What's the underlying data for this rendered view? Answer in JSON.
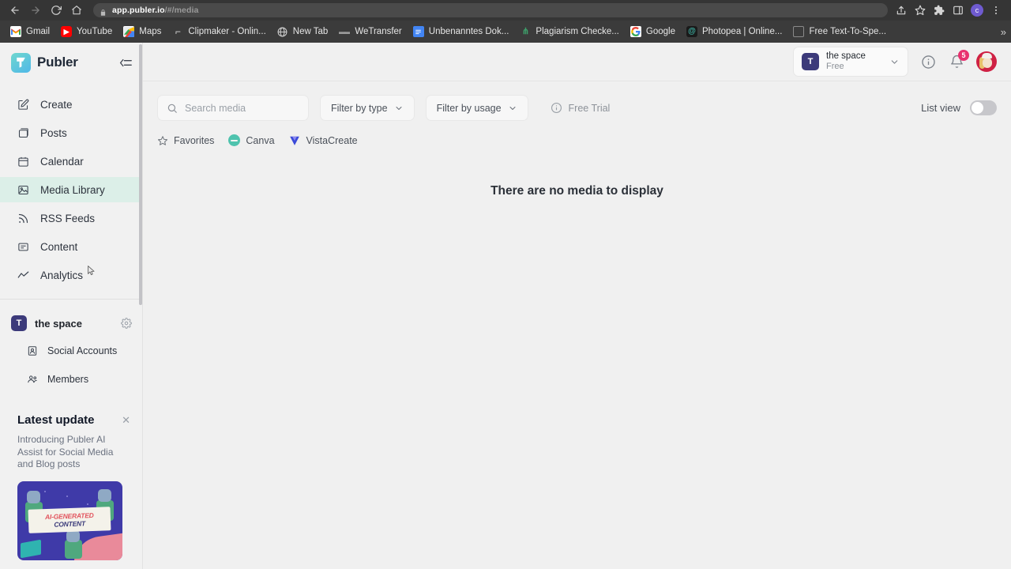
{
  "browser": {
    "url_host": "app.publer.io",
    "url_path": "/#/media",
    "nav": {
      "back": "back-arrow",
      "forward": "forward-arrow",
      "reload": "reload",
      "home": "home"
    },
    "actions": {
      "share": "share-icon",
      "bookmark": "star-icon",
      "extensions": "puzzle-icon",
      "sidepanel": "side-panel-icon",
      "profile_initial": "c",
      "menu": "kebab-menu-icon"
    },
    "bookmarks": [
      {
        "label": "Gmail",
        "icon": "gmail-icon"
      },
      {
        "label": "YouTube",
        "icon": "youtube-icon"
      },
      {
        "label": "Maps",
        "icon": "google-maps-icon"
      },
      {
        "label": "Clipmaker - Onlin...",
        "icon": "clipmaker-icon"
      },
      {
        "label": "New Tab",
        "icon": "globe-icon"
      },
      {
        "label": "WeTransfer",
        "icon": "wetransfer-icon"
      },
      {
        "label": "Unbenanntes Dok...",
        "icon": "google-docs-icon"
      },
      {
        "label": "Plagiarism Checke...",
        "icon": "plagiarism-icon"
      },
      {
        "label": "Google",
        "icon": "google-icon"
      },
      {
        "label": "Photopea | Online...",
        "icon": "photopea-icon"
      },
      {
        "label": "Free Text-To-Spe...",
        "icon": "tts-icon"
      }
    ],
    "bookmarks_overflow": "»"
  },
  "sidebar": {
    "logo_text": "Publer",
    "collapse_label": "collapse-sidebar",
    "nav_items": [
      {
        "label": "Create",
        "icon": "create-pencil-icon",
        "active": false
      },
      {
        "label": "Posts",
        "icon": "posts-icon",
        "active": false
      },
      {
        "label": "Calendar",
        "icon": "calendar-icon",
        "active": false
      },
      {
        "label": "Media Library",
        "icon": "media-library-icon",
        "active": true
      },
      {
        "label": "RSS Feeds",
        "icon": "rss-feed-icon",
        "active": false
      },
      {
        "label": "Content",
        "icon": "content-icon",
        "active": false
      },
      {
        "label": "Analytics",
        "icon": "analytics-icon",
        "active": false
      }
    ],
    "workspace": {
      "initial": "T",
      "name": "the space",
      "settings_icon": "gear-icon"
    },
    "sub_items": [
      {
        "label": "Social Accounts",
        "icon": "social-accounts-icon"
      },
      {
        "label": "Members",
        "icon": "members-icon"
      }
    ],
    "update_card": {
      "title": "Latest update",
      "close_icon": "close-icon",
      "body": "Introducing Publer AI Assist for Social Media and Blog posts",
      "image_line1_prefix": "AI",
      "image_line1": "AI-GENERATED",
      "image_line2": "CONTENT"
    }
  },
  "topbar": {
    "workspace_selector": {
      "initial": "T",
      "name": "the space",
      "plan": "Free",
      "caret_icon": "chevron-down-icon"
    },
    "info_icon": "info-icon",
    "notifications": {
      "icon": "bell-icon",
      "count": "5"
    },
    "avatar": "user-avatar"
  },
  "toolbar": {
    "search": {
      "placeholder": "Search media",
      "value": "",
      "icon": "search-icon"
    },
    "filters": [
      {
        "label": "Filter by type",
        "icon": "chevron-down-icon"
      },
      {
        "label": "Filter by usage",
        "icon": "chevron-down-icon"
      }
    ],
    "trial": {
      "label": "Free Trial",
      "icon": "info-icon"
    },
    "list_view": {
      "label": "List view",
      "enabled": false
    }
  },
  "sources": [
    {
      "label": "Favorites",
      "icon": "star-icon"
    },
    {
      "label": "Canva",
      "icon": "canva-icon"
    },
    {
      "label": "VistaCreate",
      "icon": "vistacreate-icon"
    }
  ],
  "main": {
    "empty_message": "There are no media to display"
  },
  "colors": {
    "accent_green": "#2eb67d",
    "active_bg": "#dcefe8",
    "sidebar_bg": "#f1f1f1",
    "workspace_badge": "#3c3a7a",
    "badge_pink": "#e8316f",
    "canva_teal": "#4fc3ae"
  }
}
